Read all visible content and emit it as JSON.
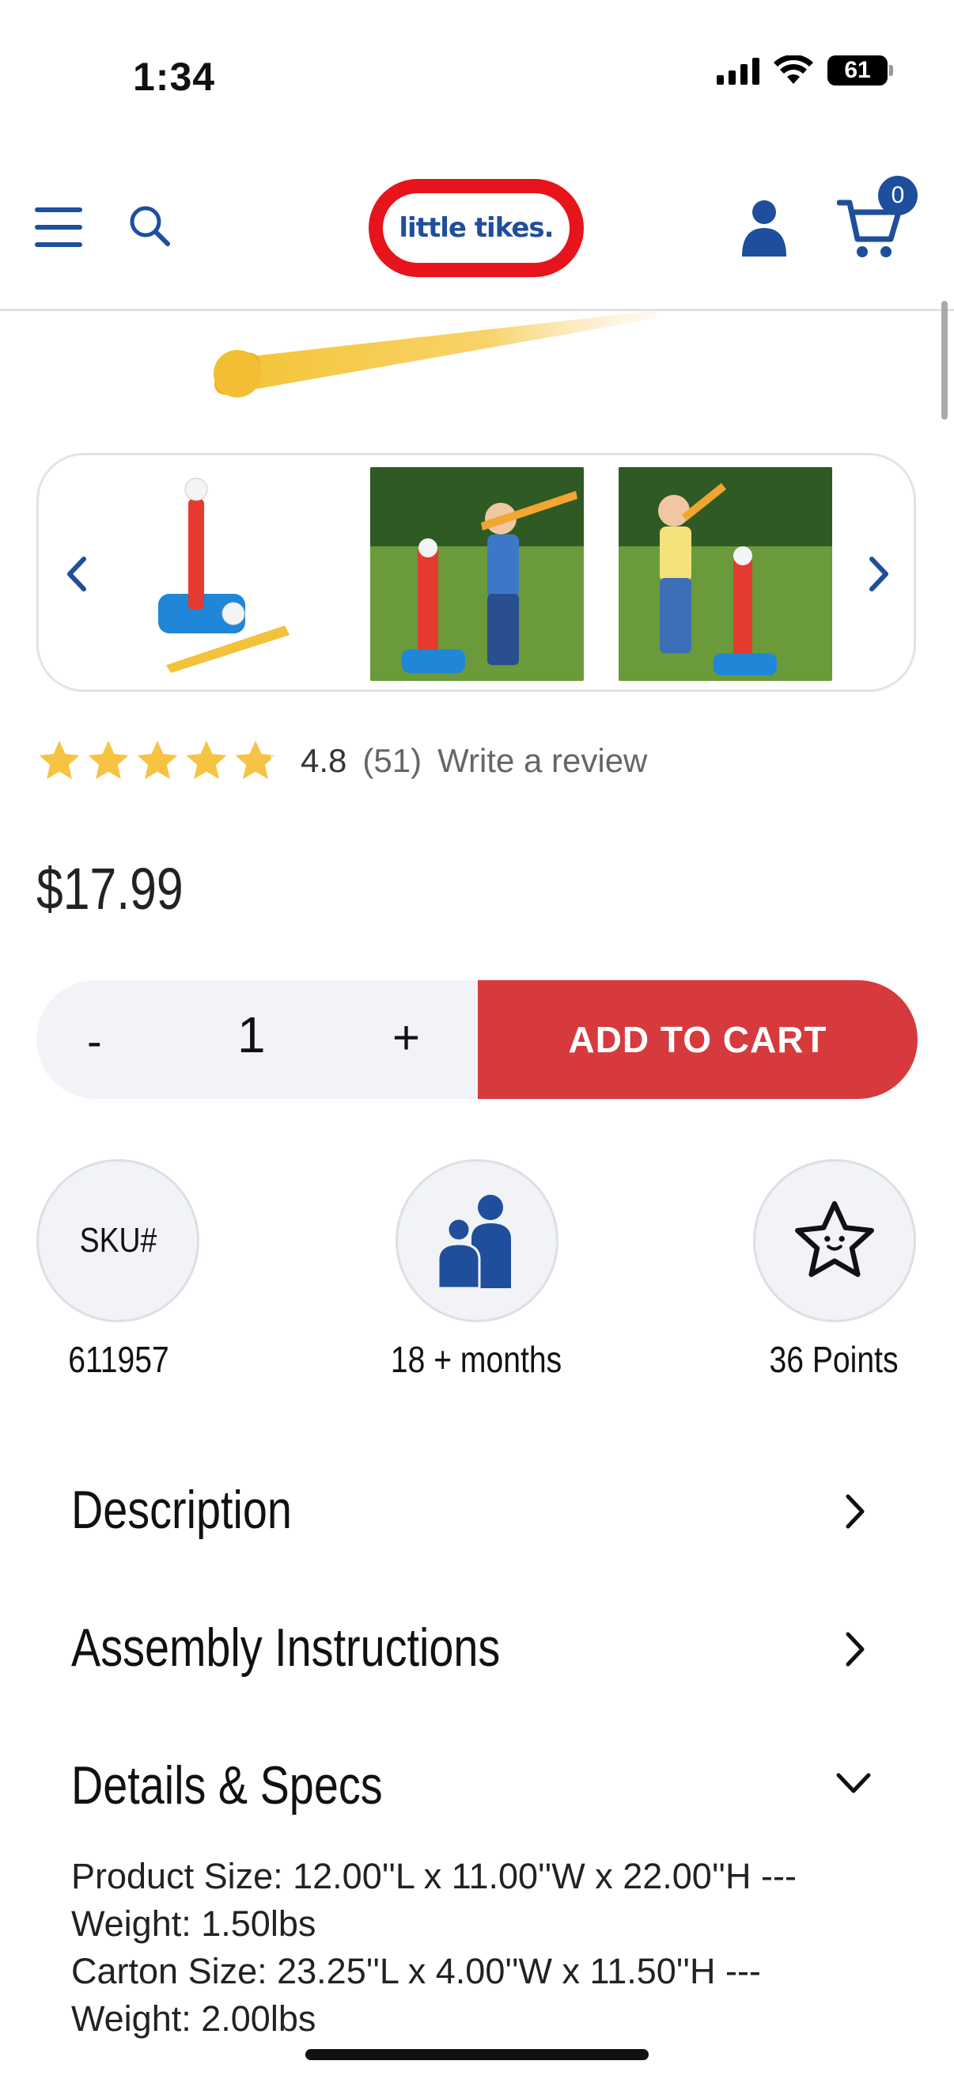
{
  "status_bar": {
    "time": "1:34",
    "battery": "61"
  },
  "header": {
    "logo_text": "little tikes.",
    "cart_count": "0"
  },
  "icons": {
    "menu": "hamburger-icon",
    "search": "search-icon",
    "user": "user-icon",
    "cart": "cart-icon",
    "prev": "chevron-left-icon",
    "next": "chevron-right-icon",
    "star": "star-icon",
    "people": "people-icon",
    "points": "star-face-icon"
  },
  "colors": {
    "brand_blue": "#1f4e9c",
    "logo_red": "#e8141b",
    "cta_red": "#d63a3d",
    "star_gold": "#f6c343"
  },
  "product": {
    "rating": "4.8",
    "review_count": "(51)",
    "write_review": "Write a review",
    "star_fill": 0.96,
    "price": "$17.99"
  },
  "purchase": {
    "minus": "-",
    "quantity": "1",
    "plus": "+",
    "add_to_cart": "ADD TO CART"
  },
  "info": {
    "sku_label": "SKU#",
    "sku": "611957",
    "age": "18 + months",
    "points": "36 Points"
  },
  "accordion": [
    {
      "title": "Description",
      "state": "collapsed"
    },
    {
      "title": "Assembly Instructions",
      "state": "collapsed"
    },
    {
      "title": "Details & Specs",
      "state": "expanded"
    }
  ],
  "details": {
    "line1": "Product Size: 12.00''L x 11.00''W x 22.00''H --- Weight: 1.50lbs",
    "line2": "Carton Size: 23.25''L x 4.00''W x 11.50''H --- Weight: 2.00lbs"
  }
}
